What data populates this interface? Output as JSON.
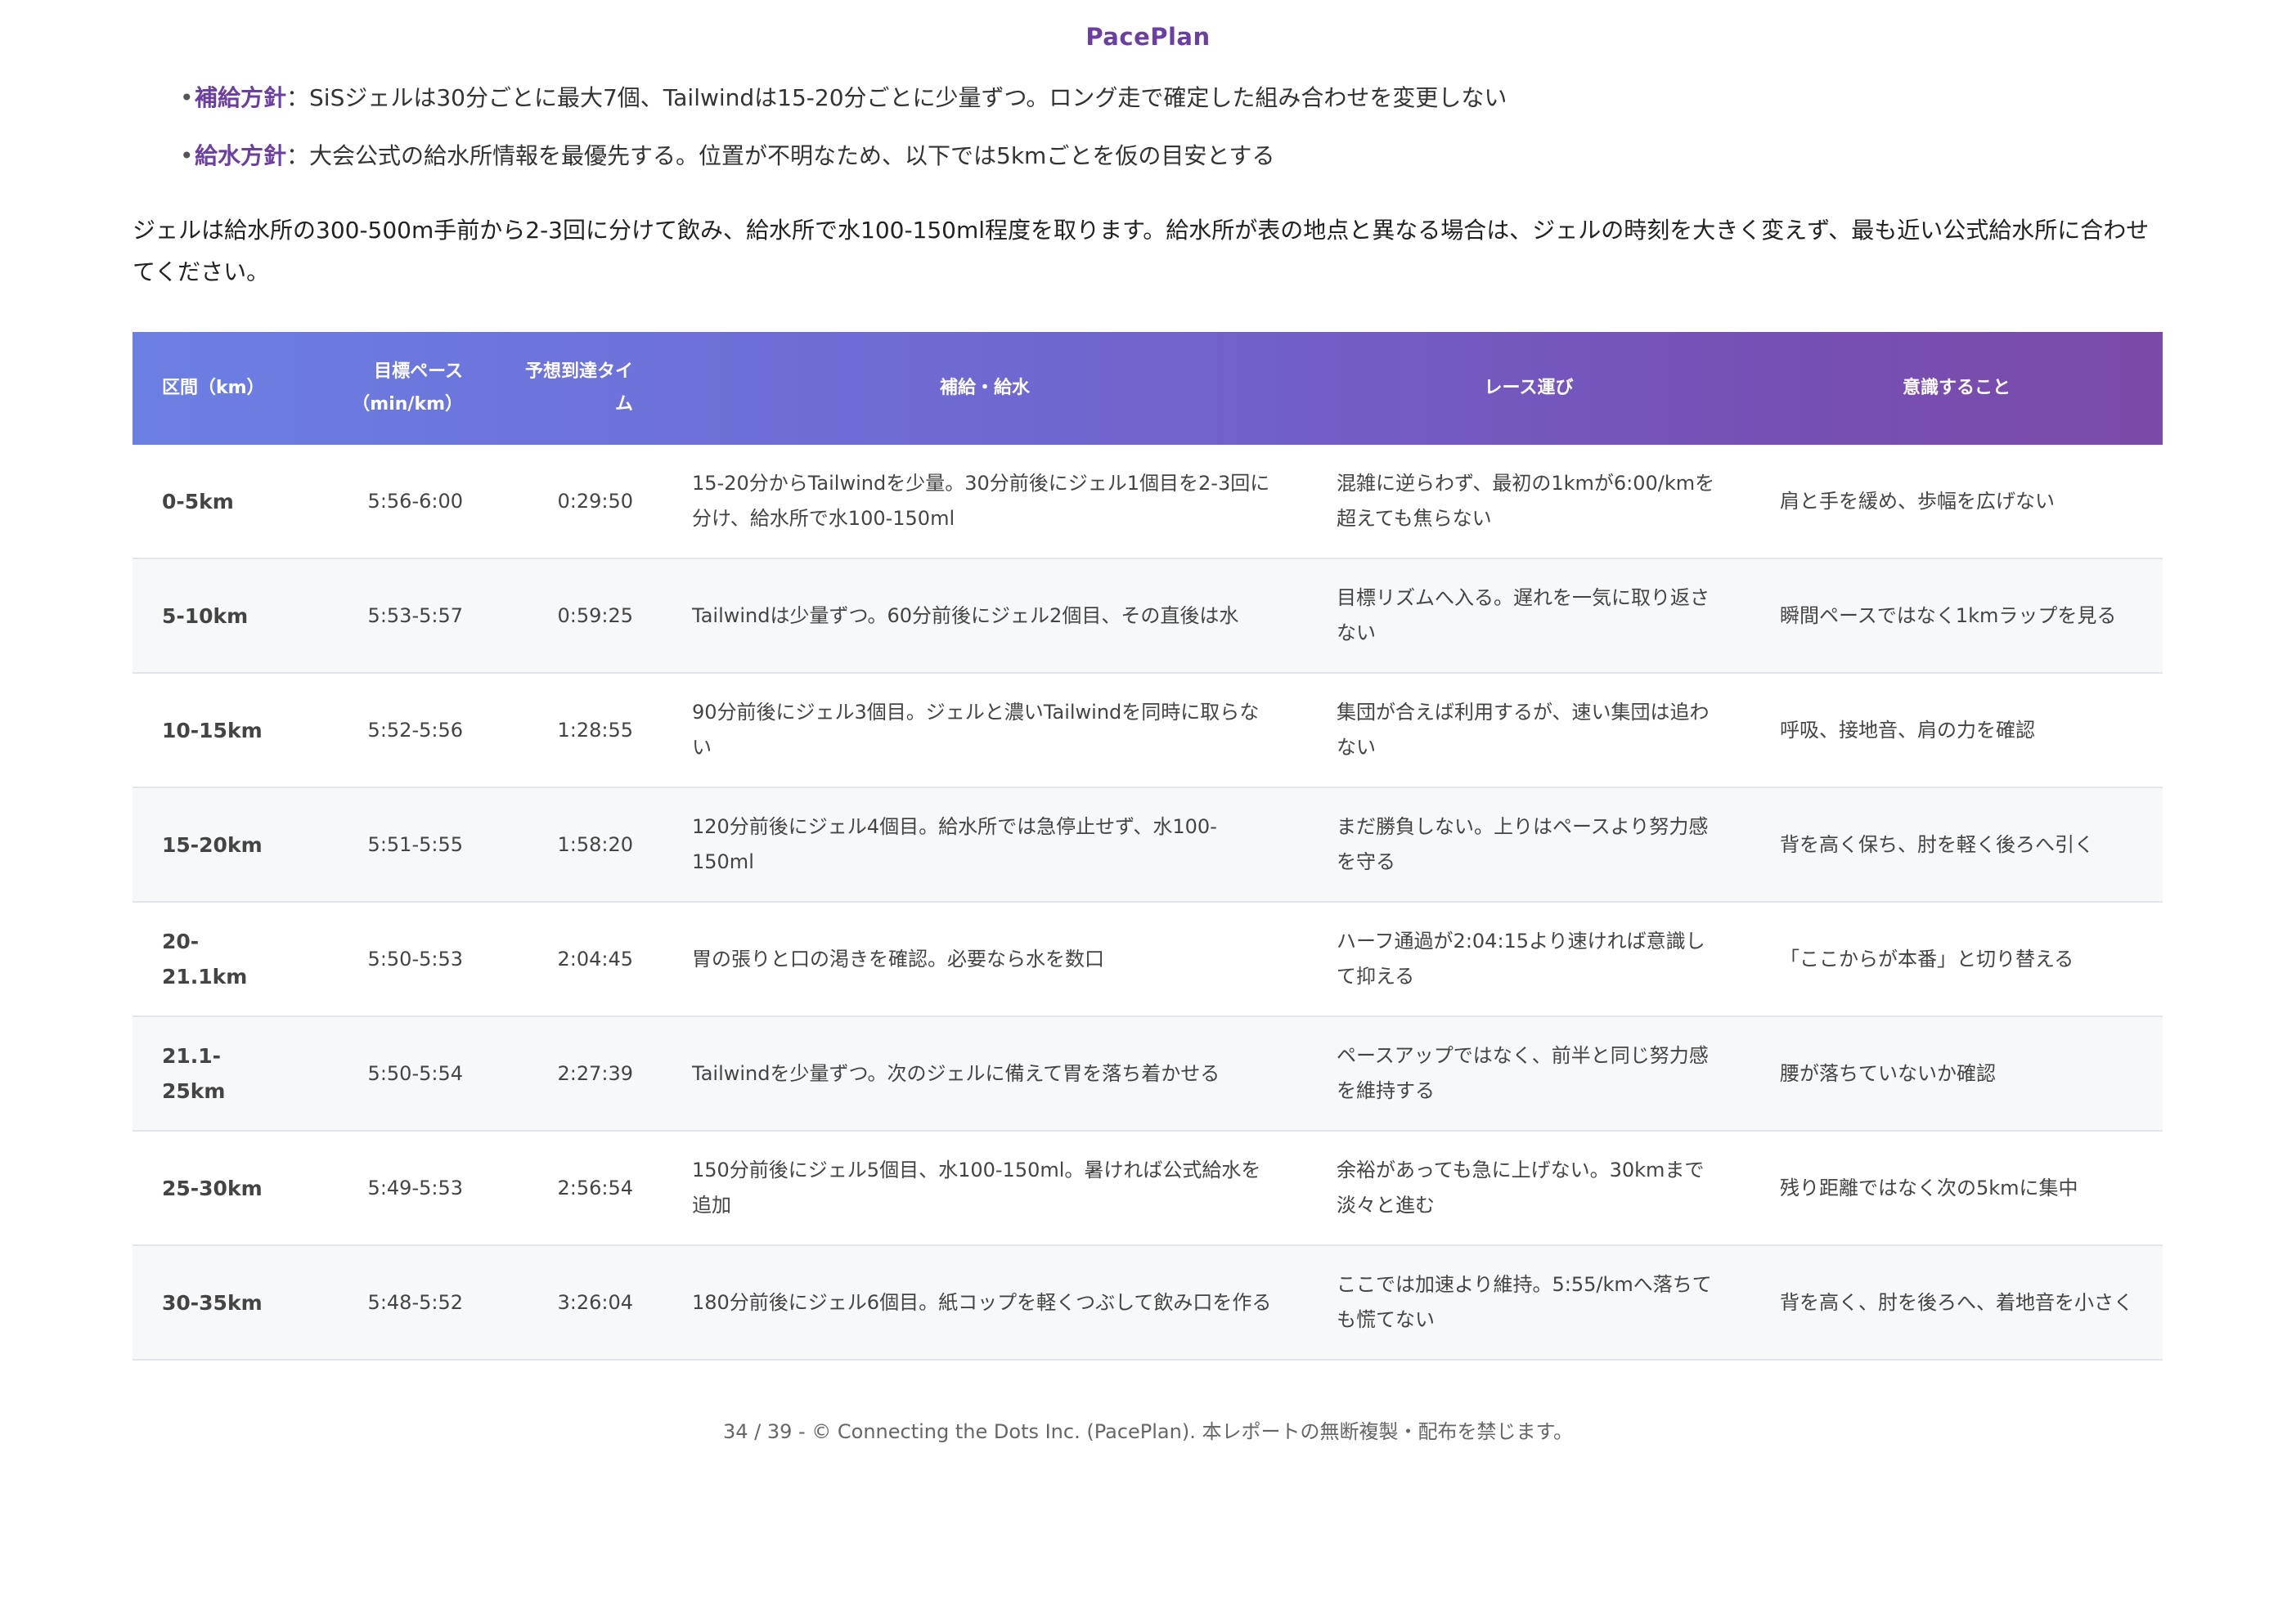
{
  "header": {
    "brand": "PacePlan"
  },
  "bullets": [
    {
      "marker": "•",
      "key": "補給方針",
      "text": "：SiSジェルは30分ごとに最大7個、Tailwindは15-20分ごとに少量ずつ。ロング走で確定した組み合わせを変更しない"
    },
    {
      "marker": "•",
      "key": "給水方針",
      "text": "：大会公式の給水所情報を最優先する。位置が不明なため、以下では5kmごとを仮の目安とする"
    }
  ],
  "intro": "ジェルは給水所の300-500m手前から2-3回に分けて飲み、給水所で水100-150ml程度を取ります。給水所が表の地点と異なる場合は、ジェルの時刻を大きく変えず、最も近い公式給水所に合わせてください。",
  "table": {
    "headers": {
      "segment": "区間（km）",
      "pace": "目標ペース（min/km）",
      "eta": "予想到達タイム",
      "fuel": "補給・給水",
      "strategy": "レース運び",
      "focus": "意識すること"
    },
    "rows": [
      {
        "segment": "0-5km",
        "pace": "5:56-6:00",
        "eta": "0:29:50",
        "fuel": "15-20分からTailwindを少量。30分前後にジェル1個目を2-3回に分け、給水所で水100-150ml",
        "strategy": "混雑に逆らわず、最初の1kmが6:00/kmを超えても焦らない",
        "focus": "肩と手を緩め、歩幅を広げない"
      },
      {
        "segment": "5-10km",
        "pace": "5:53-5:57",
        "eta": "0:59:25",
        "fuel": "Tailwindは少量ずつ。60分前後にジェル2個目、その直後は水",
        "strategy": "目標リズムへ入る。遅れを一気に取り返さない",
        "focus": "瞬間ペースではなく1kmラップを見る"
      },
      {
        "segment": "10-15km",
        "pace": "5:52-5:56",
        "eta": "1:28:55",
        "fuel": "90分前後にジェル3個目。ジェルと濃いTailwindを同時に取らない",
        "strategy": "集団が合えば利用するが、速い集団は追わない",
        "focus": "呼吸、接地音、肩の力を確認"
      },
      {
        "segment": "15-20km",
        "pace": "5:51-5:55",
        "eta": "1:58:20",
        "fuel": "120分前後にジェル4個目。給水所では急停止せず、水100-150ml",
        "strategy": "まだ勝負しない。上りはペースより努力感を守る",
        "focus": "背を高く保ち、肘を軽く後ろへ引く"
      },
      {
        "segment": "20-21.1km",
        "pace": "5:50-5:53",
        "eta": "2:04:45",
        "fuel": "胃の張りと口の渇きを確認。必要なら水を数口",
        "strategy": "ハーフ通過が2:04:15より速ければ意識して抑える",
        "focus": "「ここからが本番」と切り替える"
      },
      {
        "segment": "21.1-25km",
        "pace": "5:50-5:54",
        "eta": "2:27:39",
        "fuel": "Tailwindを少量ずつ。次のジェルに備えて胃を落ち着かせる",
        "strategy": "ペースアップではなく、前半と同じ努力感を維持する",
        "focus": "腰が落ちていないか確認"
      },
      {
        "segment": "25-30km",
        "pace": "5:49-5:53",
        "eta": "2:56:54",
        "fuel": "150分前後にジェル5個目、水100-150ml。暑ければ公式給水を追加",
        "strategy": "余裕があっても急に上げない。30kmまで淡々と進む",
        "focus": "残り距離ではなく次の5kmに集中"
      },
      {
        "segment": "30-35km",
        "pace": "5:48-5:52",
        "eta": "3:26:04",
        "fuel": "180分前後にジェル6個目。紙コップを軽くつぶして飲み口を作る",
        "strategy": "ここでは加速より維持。5:55/kmへ落ちても慌てない",
        "focus": "背を高く、肘を後ろへ、着地音を小さく"
      }
    ]
  },
  "footer": "34 / 39 - © Connecting the Dots Inc. (PacePlan). 本レポートの無断複製・配布を禁じます。"
}
